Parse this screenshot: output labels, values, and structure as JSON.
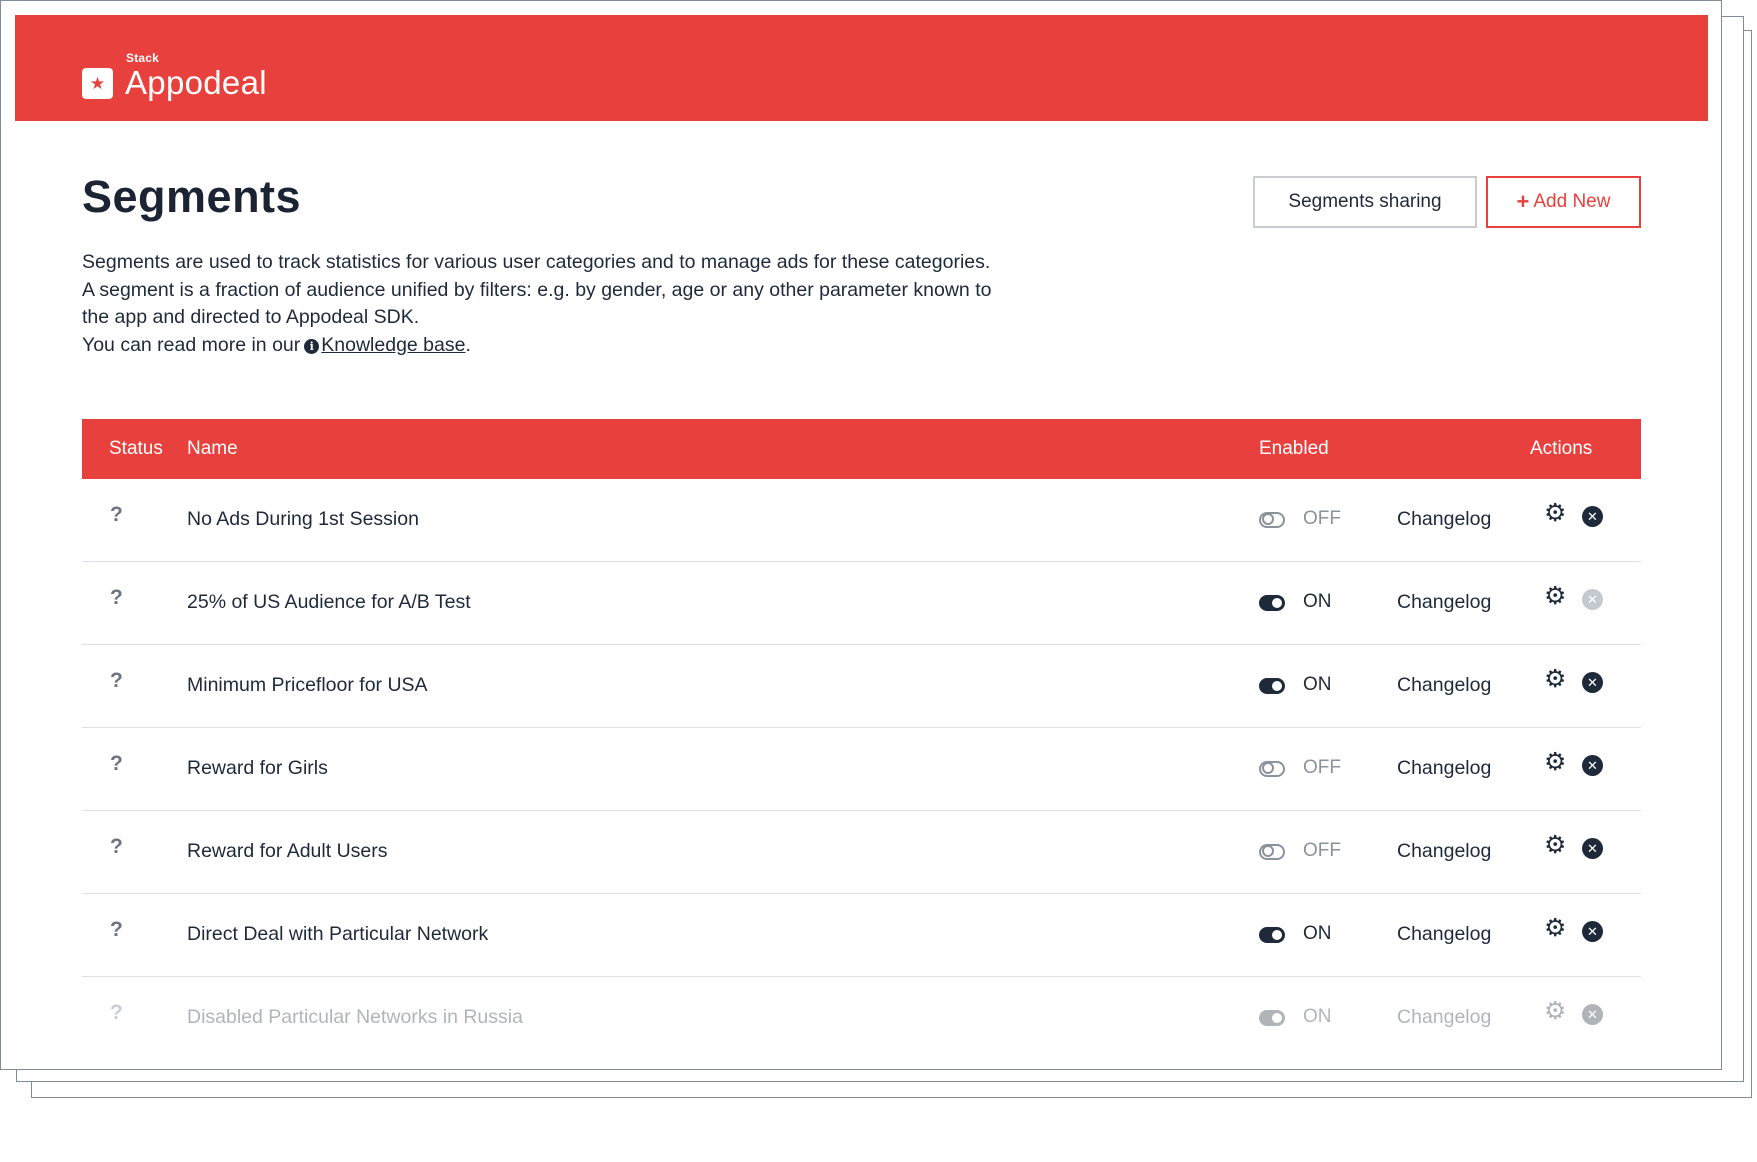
{
  "app": {
    "brand_small": "Stack",
    "brand_name": "Appodeal",
    "logo_glyph": "★",
    "accent_color": "#e8403c"
  },
  "page": {
    "title": "Segments",
    "description_line1": "Segments are used to track statistics for various user categories and to manage ads for these categories. A segment is a fraction of audience unified by filters: e.g. by gender, age or any other parameter known to the app and directed to Appodeal SDK.",
    "description_line2_prefix": "You can read more in our",
    "knowledge_link": "Knowledge base",
    "description_line2_suffix": "."
  },
  "buttons": {
    "share_label": "Segments sharing",
    "add_label": "Add New"
  },
  "table": {
    "columns": {
      "status": "Status",
      "name": "Name",
      "enabled": "Enabled",
      "actions": "Actions"
    },
    "rows": [
      {
        "status": "?",
        "name": "No Ads During 1st Session",
        "state": "OFF",
        "changelog": "Changelog",
        "delete_dim": false
      },
      {
        "status": "?",
        "name": "25% of US Audience for A/B Test",
        "state": "ON",
        "changelog": "Changelog",
        "delete_dim": true
      },
      {
        "status": "?",
        "name": "Minimum Pricefloor for USA",
        "state": "ON",
        "changelog": "Changelog",
        "delete_dim": false
      },
      {
        "status": "?",
        "name": "Reward for Girls",
        "state": "OFF",
        "changelog": "Changelog",
        "delete_dim": false
      },
      {
        "status": "?",
        "name": "Reward for Adult Users",
        "state": "OFF",
        "changelog": "Changelog",
        "delete_dim": false
      },
      {
        "status": "?",
        "name": "Direct Deal with Particular Network",
        "state": "ON",
        "changelog": "Changelog",
        "delete_dim": false
      },
      {
        "status": "?",
        "name": "Disabled Particular Networks in Russia",
        "state": "ON",
        "changelog": "Changelog",
        "delete_dim": false
      }
    ]
  },
  "icons": {
    "gear": "⚙",
    "close": "✕",
    "info": "i",
    "plus": "+"
  }
}
